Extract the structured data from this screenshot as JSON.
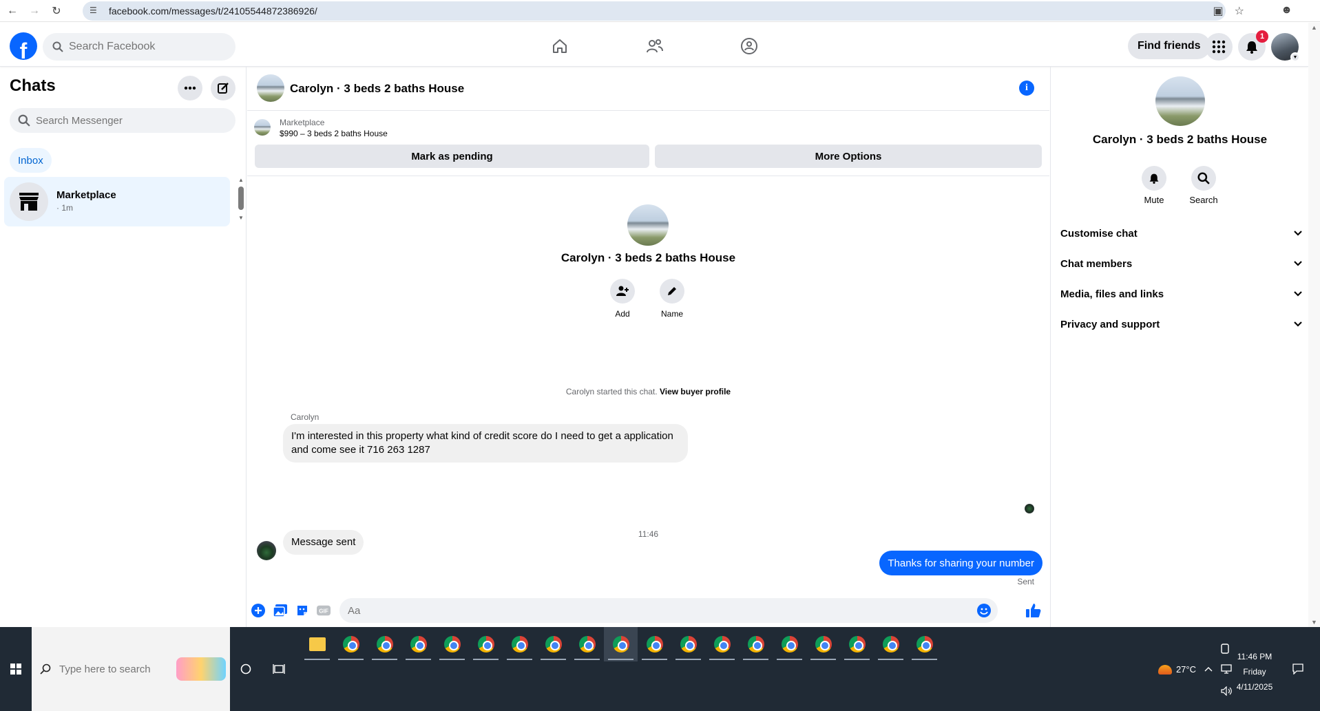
{
  "browser": {
    "url": "facebook.com/messages/t/24105544872386926/"
  },
  "topbar": {
    "search_placeholder": "Search Facebook",
    "find_friends": "Find friends",
    "notification_count": "1"
  },
  "sidebar": {
    "title": "Chats",
    "search_placeholder": "Search Messenger",
    "inbox_label": "Inbox",
    "chats": [
      {
        "name": "Marketplace",
        "time": "· 1m"
      }
    ]
  },
  "chat": {
    "title": "Carolyn · 3 beds 2 baths House",
    "marketplace_label": "Marketplace",
    "listing": "$990 – 3 beds 2 baths House",
    "mark_pending": "Mark as pending",
    "more_options": "More Options",
    "intro_name": "Carolyn · 3 beds 2 baths House",
    "add_label": "Add",
    "name_label": "Name",
    "started_text": "Carolyn started this chat.",
    "view_buyer": "View buyer profile",
    "sender": "Carolyn",
    "messages_in": [
      "I'm interested in this property what kind of credit score do I need to get a application and come see it 716 263 1287",
      "Message sent"
    ],
    "timestamp": "11:46",
    "message_out": "Thanks for sharing your number",
    "sent_status": "Sent",
    "composer_placeholder": "Aa"
  },
  "details": {
    "name": "Carolyn · 3 beds 2 baths House",
    "mute": "Mute",
    "search": "Search",
    "sections": [
      "Customise chat",
      "Chat members",
      "Media, files and links",
      "Privacy and support"
    ]
  },
  "taskbar": {
    "search_placeholder": "Type here to search",
    "temperature": "27°C",
    "time": "11:46 PM",
    "day": "Friday",
    "date": "4/11/2025"
  },
  "colors": {
    "fb_blue": "#0866ff",
    "bubble_gray": "#f0f0f0",
    "selected_bg": "#ebf5ff",
    "taskbar": "#202a35"
  }
}
